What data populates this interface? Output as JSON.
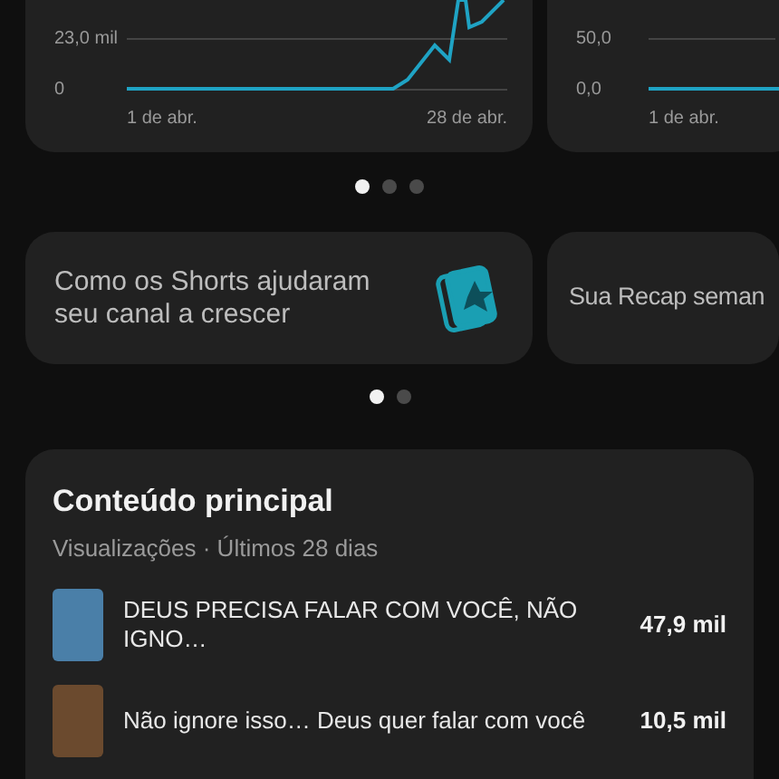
{
  "chart_cards": [
    {
      "kind": "rising",
      "y_ticks": [
        "23,0 mil",
        "0"
      ],
      "x_labels": [
        "1 de abr.",
        "28 de abr."
      ]
    },
    {
      "kind": "flat",
      "y_ticks": [
        "50,0",
        "0,0"
      ],
      "x_labels": [
        "1 de abr."
      ]
    }
  ],
  "chart_pager": [
    {
      "selected": true
    },
    {
      "selected": false
    },
    {
      "selected": false
    }
  ],
  "promo_cards": [
    {
      "kind": "shorts",
      "text": "Como os Shorts ajudaram seu canal a crescer"
    },
    {
      "kind": "plain",
      "text": "Sua Recap seman"
    }
  ],
  "promo_pager": [
    {
      "selected": true
    },
    {
      "selected": false
    }
  ],
  "top_content": {
    "title": "Conteúdo principal",
    "subtitle": "Visualizações · Últimos 28 dias",
    "items": [
      {
        "title": "DEUS PRECISA FALAR COM VOCÊ, NÃO IGNO…",
        "views": "47,9 mil",
        "color": "#4a7fa8"
      },
      {
        "title": "Não ignore isso… Deus quer falar com você",
        "views": "10,5 mil",
        "color": "#6b4a2e"
      }
    ]
  }
}
